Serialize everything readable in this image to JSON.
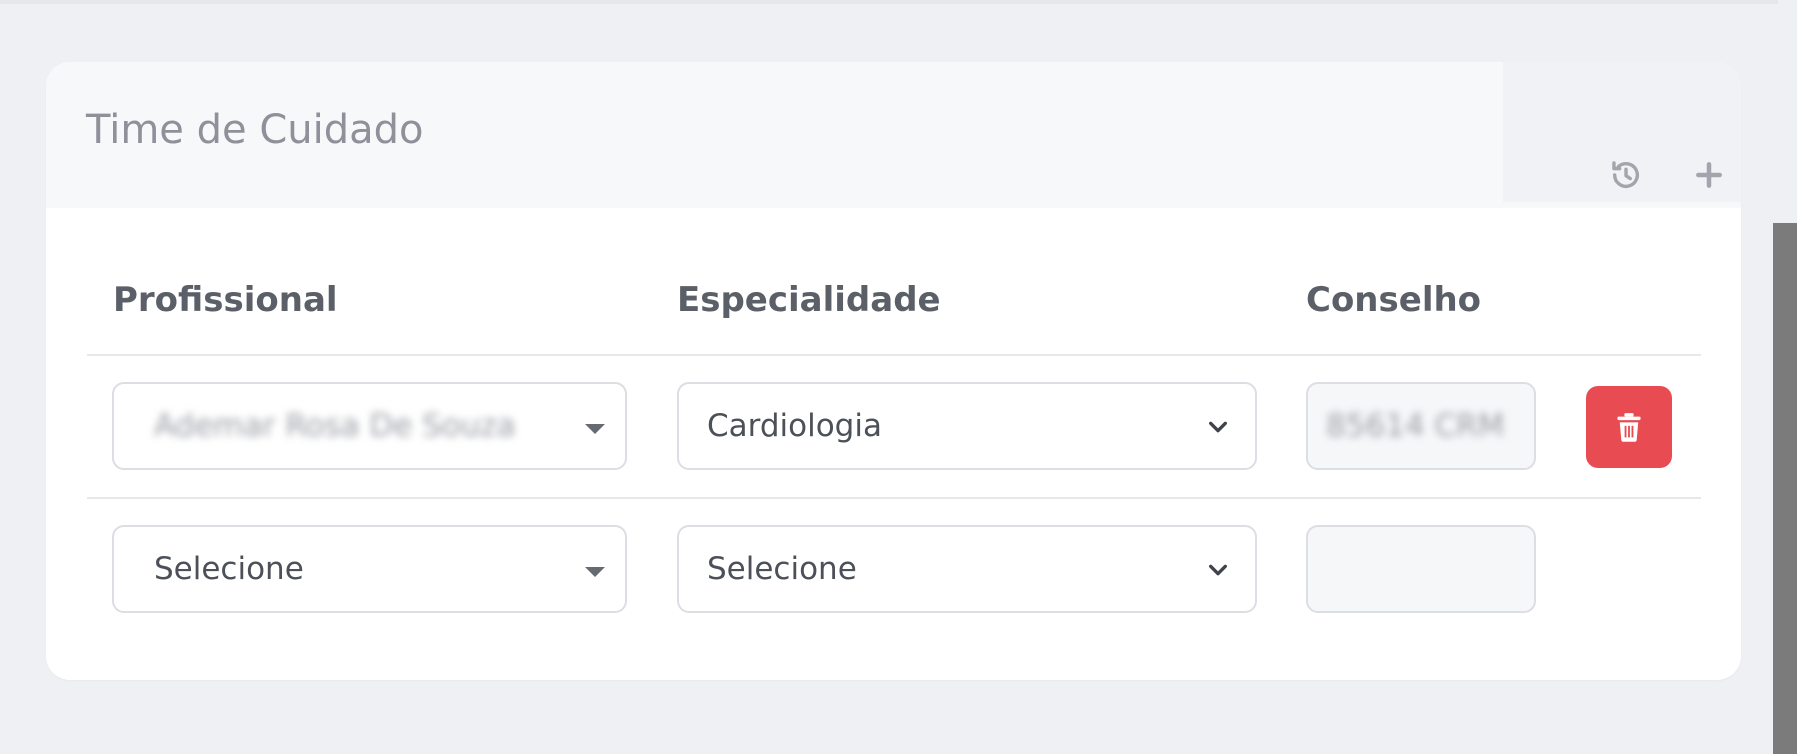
{
  "card": {
    "title": "Time de Cuidado",
    "actions": {
      "history_icon": "history-icon",
      "add_icon": "plus-icon"
    }
  },
  "table": {
    "columns": [
      "Profissional",
      "Especialidade",
      "Conselho"
    ],
    "rows": [
      {
        "profissional": "Ademar Rosa De Souza",
        "especialidade": "Cardiologia",
        "conselho": "85614 CRM",
        "delete_icon": "trash-icon"
      },
      {
        "profissional": "Selecione",
        "especialidade": "Selecione",
        "conselho": ""
      }
    ]
  },
  "colors": {
    "delete": "#e84c52",
    "background": "#eff0f4"
  }
}
